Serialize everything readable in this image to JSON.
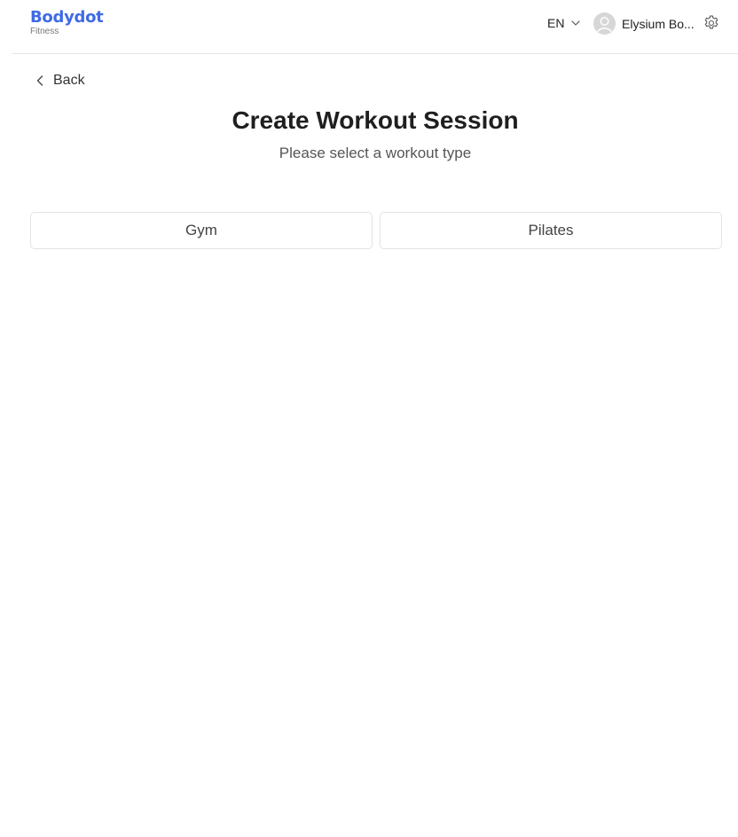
{
  "brand": {
    "name": "Bodydot",
    "subtitle": "Fitness",
    "color": "#3f6ae6"
  },
  "header": {
    "language": "EN",
    "user_name": "Elysium Bo...",
    "icons": {
      "language_dropdown": "chevron-down-icon",
      "avatar": "user-avatar-icon",
      "settings": "gear-icon"
    }
  },
  "nav": {
    "back_label": "Back",
    "back_icon": "chevron-left-icon"
  },
  "page": {
    "title": "Create Workout Session",
    "subtitle": "Please select a workout type"
  },
  "workout_types": [
    {
      "label": "Gym"
    },
    {
      "label": "Pilates"
    }
  ]
}
